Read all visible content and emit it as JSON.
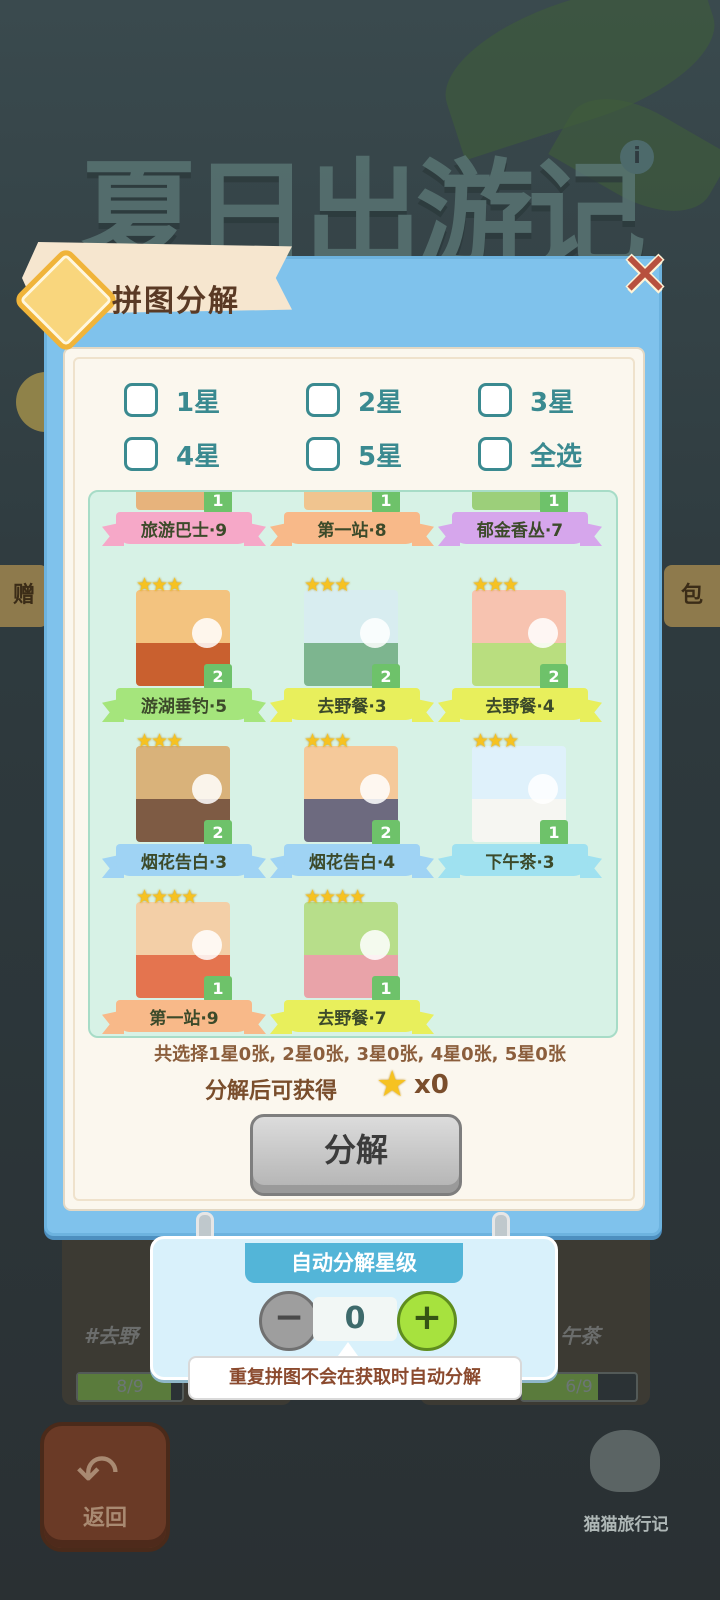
{
  "background": {
    "title": "夏日出游记",
    "side_left": "赠",
    "side_right": "包",
    "card_left_label": "#去野",
    "card_right_label": "午茶",
    "card_left_progress": "8/9",
    "card_right_progress": "6/9",
    "card_left_fraction": 0.89,
    "card_right_fraction": 0.67,
    "back_label": "返回",
    "logo_text": "猫猫旅行记"
  },
  "dialog": {
    "title": "拼图分解",
    "close_icon": "close-icon"
  },
  "filters": [
    {
      "label": "1星"
    },
    {
      "label": "2星"
    },
    {
      "label": "3星"
    },
    {
      "label": "4星"
    },
    {
      "label": "5星"
    },
    {
      "label": "全选"
    }
  ],
  "pieces": [
    {
      "name": "旅游巴士·9",
      "stars": "",
      "count": "1",
      "ribbon_color": "#f6a8c8",
      "sky": "#f4e6c9",
      "ground": "#e7b37c"
    },
    {
      "name": "第一站·8",
      "stars": "",
      "count": "1",
      "ribbon_color": "#f8b989",
      "sky": "#f6e6d2",
      "ground": "#f0c48f"
    },
    {
      "name": "郁金香丛·7",
      "stars": "",
      "count": "1",
      "ribbon_color": "#d6a6ec",
      "sky": "#dff0d4",
      "ground": "#9ccf7a"
    },
    {
      "name": "游湖垂钓·5",
      "stars": "★★★",
      "count": "2",
      "ribbon_color": "#a5e57c",
      "sky": "#f3c37f",
      "ground": "#c9602f"
    },
    {
      "name": "去野餐·3",
      "stars": "★★★",
      "count": "2",
      "ribbon_color": "#e8ef5c",
      "sky": "#d8edf0",
      "ground": "#7db58f"
    },
    {
      "name": "去野餐·4",
      "stars": "★★★",
      "count": "2",
      "ribbon_color": "#e8ef5c",
      "sky": "#f7c3b0",
      "ground": "#b9de7f"
    },
    {
      "name": "烟花告白·3",
      "stars": "★★★",
      "count": "2",
      "ribbon_color": "#9fd3f4",
      "sky": "#d9b27a",
      "ground": "#7e5b44"
    },
    {
      "name": "烟花告白·4",
      "stars": "★★★",
      "count": "2",
      "ribbon_color": "#9fd3f4",
      "sky": "#f5c99a",
      "ground": "#6d6a7f"
    },
    {
      "name": "下午茶·3",
      "stars": "★★★",
      "count": "1",
      "ribbon_color": "#9fe1f0",
      "sky": "#dff1fb",
      "ground": "#f6f6f2"
    },
    {
      "name": "第一站·9",
      "stars": "★★★★",
      "count": "1",
      "ribbon_color": "#f8b989",
      "sky": "#f3cfa7",
      "ground": "#e4744f"
    },
    {
      "name": "去野餐·7",
      "stars": "★★★★",
      "count": "1",
      "ribbon_color": "#e8ef5c",
      "sky": "#b7de8a",
      "ground": "#e9a3a9"
    }
  ],
  "summary": "共选择1星0张, 2星0张, 3星0张, 4星0张, 5星0张",
  "gain_label": "分解后可获得",
  "gain_count": "x0",
  "decompose_button": "分解",
  "auto": {
    "title": "自动分解星级",
    "value": "0",
    "tip": "重复拼图不会在获取时自动分解"
  }
}
